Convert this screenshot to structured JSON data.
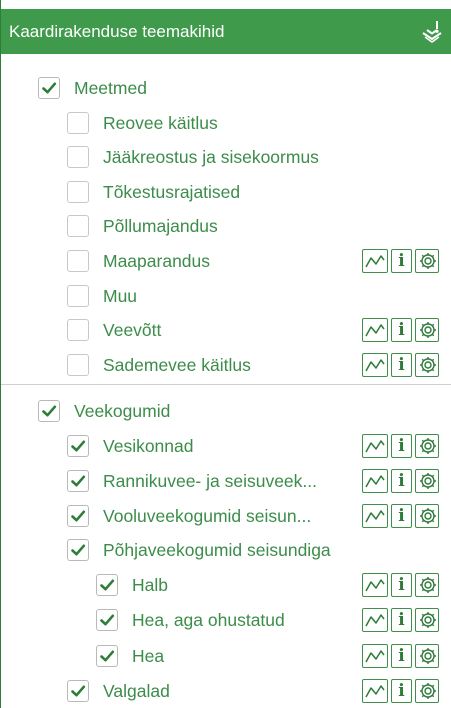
{
  "panel": {
    "title": "Kaardirakenduse teemakihid",
    "icon": "layers-download-icon"
  },
  "groups": [
    {
      "label": "Meetmed",
      "checked": true,
      "items": [
        {
          "label": "Reovee käitlus",
          "checked": false,
          "tools": false
        },
        {
          "label": "Jääkreostus ja sisekoormus",
          "checked": false,
          "tools": false
        },
        {
          "label": "Tõkestusrajatised",
          "checked": false,
          "tools": false
        },
        {
          "label": "Põllumajandus",
          "checked": false,
          "tools": false
        },
        {
          "label": "Maaparandus",
          "checked": false,
          "tools": true
        },
        {
          "label": "Muu",
          "checked": false,
          "tools": false
        },
        {
          "label": "Veevõtt",
          "checked": false,
          "tools": true
        },
        {
          "label": "Sademevee käitlus",
          "checked": false,
          "tools": true
        }
      ]
    },
    {
      "label": "Veekogumid",
      "checked": true,
      "items": [
        {
          "label": "Vesikonnad",
          "checked": true,
          "tools": true
        },
        {
          "label": "Rannikuvee- ja seisuveek...",
          "checked": true,
          "tools": true
        },
        {
          "label": "Vooluveekogumid seisun...",
          "checked": true,
          "tools": true
        },
        {
          "label": "Põhjaveekogumid seisundiga",
          "checked": true,
          "tools": false,
          "children": [
            {
              "label": "Halb",
              "checked": true,
              "tools": true
            },
            {
              "label": "Hea, aga ohustatud",
              "checked": true,
              "tools": true
            },
            {
              "label": "Hea",
              "checked": true,
              "tools": true
            }
          ]
        },
        {
          "label": "Valgalad",
          "checked": true,
          "tools": true
        }
      ]
    }
  ],
  "tool_icons": {
    "chart": "line-chart-icon",
    "info": "i",
    "settings": "gear-icon"
  },
  "colors": {
    "header_bg": "#3f9a4c",
    "text": "#3c8c4a",
    "check": "#2e7d3a"
  }
}
